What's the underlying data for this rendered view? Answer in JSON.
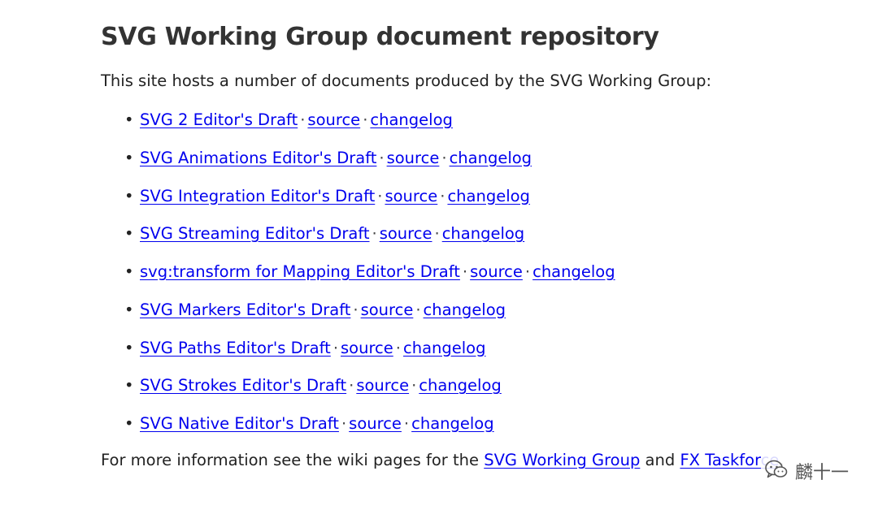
{
  "title": "SVG Working Group document repository",
  "intro": "This site hosts a number of documents produced by the SVG Working Group:",
  "separator": "·",
  "documents": [
    {
      "draft": "SVG 2 Editor's Draft",
      "source": "source",
      "changelog": "changelog"
    },
    {
      "draft": "SVG Animations Editor's Draft",
      "source": "source",
      "changelog": "changelog"
    },
    {
      "draft": "SVG Integration Editor's Draft",
      "source": "source",
      "changelog": "changelog"
    },
    {
      "draft": "SVG Streaming Editor's Draft",
      "source": "source",
      "changelog": "changelog"
    },
    {
      "draft": "svg:transform for Mapping Editor's Draft",
      "source": "source",
      "changelog": "changelog"
    },
    {
      "draft": "SVG Markers Editor's Draft",
      "source": "source",
      "changelog": "changelog"
    },
    {
      "draft": "SVG Paths Editor's Draft",
      "source": "source",
      "changelog": "changelog"
    },
    {
      "draft": "SVG Strokes Editor's Draft",
      "source": "source",
      "changelog": "changelog"
    },
    {
      "draft": "SVG Native Editor's Draft",
      "source": "source",
      "changelog": "changelog"
    }
  ],
  "footer": {
    "prefix": "For more information see the wiki pages for the ",
    "link1": "SVG Working Group",
    "conjunction": " and ",
    "link2": "FX Taskforce",
    "suffix": "."
  },
  "watermark": {
    "icon": "wechat-icon",
    "text": "麟十一"
  },
  "colors": {
    "link": "#0000ee",
    "heading": "#333333",
    "text": "#222222"
  }
}
